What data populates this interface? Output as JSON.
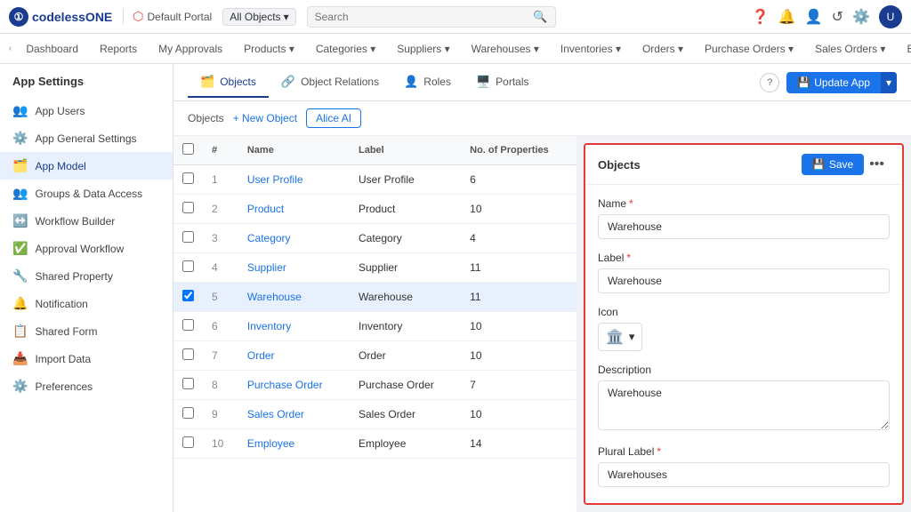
{
  "topBar": {
    "logo": "codelessONE",
    "portal": "Default Portal",
    "allObjects": "All Objects",
    "searchPlaceholder": "Search"
  },
  "secondNav": {
    "items": [
      {
        "label": "Dashboard"
      },
      {
        "label": "Reports"
      },
      {
        "label": "My Approvals"
      },
      {
        "label": "Products",
        "hasDropdown": true
      },
      {
        "label": "Categories",
        "hasDropdown": true
      },
      {
        "label": "Suppliers",
        "hasDropdown": true
      },
      {
        "label": "Warehouses",
        "hasDropdown": true
      },
      {
        "label": "Inventories",
        "hasDropdown": true
      },
      {
        "label": "Orders",
        "hasDropdown": true
      },
      {
        "label": "Purchase Orders",
        "hasDropdown": true
      },
      {
        "label": "Sales Orders",
        "hasDropdown": true
      },
      {
        "label": "Emplo…"
      }
    ]
  },
  "sidebar": {
    "title": "App Settings",
    "items": [
      {
        "label": "App Users",
        "icon": "👥"
      },
      {
        "label": "App General Settings",
        "icon": "⚙️"
      },
      {
        "label": "App Model",
        "icon": "🗂️",
        "active": true
      },
      {
        "label": "Groups & Data Access",
        "icon": "👥"
      },
      {
        "label": "Workflow Builder",
        "icon": "↔️"
      },
      {
        "label": "Approval Workflow",
        "icon": "✅"
      },
      {
        "label": "Shared Property",
        "icon": "🔧"
      },
      {
        "label": "Notification",
        "icon": "🔔"
      },
      {
        "label": "Shared Form",
        "icon": "📋"
      },
      {
        "label": "Import Data",
        "icon": "📥"
      },
      {
        "label": "Preferences",
        "icon": "⚙️"
      }
    ]
  },
  "tabs": [
    {
      "label": "Objects",
      "icon": "🗂️",
      "active": true
    },
    {
      "label": "Object Relations",
      "icon": "🔗"
    },
    {
      "label": "Roles",
      "icon": "👤"
    },
    {
      "label": "Portals",
      "icon": "🖥️"
    }
  ],
  "toolbar": {
    "objectsLabel": "Objects",
    "newObjectLabel": "+ New Object",
    "aiLabel": "Alice AI",
    "updateAppLabel": "Update App",
    "helpTooltip": "?"
  },
  "table": {
    "headers": [
      "#",
      "Name",
      "Label",
      "No. of Properties"
    ],
    "rows": [
      {
        "num": 1,
        "name": "User Profile",
        "label": "User Profile",
        "properties": 6
      },
      {
        "num": 2,
        "name": "Product",
        "label": "Product",
        "properties": 10
      },
      {
        "num": 3,
        "name": "Category",
        "label": "Category",
        "properties": 4
      },
      {
        "num": 4,
        "name": "Supplier",
        "label": "Supplier",
        "properties": 11
      },
      {
        "num": 5,
        "name": "Warehouse",
        "label": "Warehouse",
        "properties": 11,
        "selected": true
      },
      {
        "num": 6,
        "name": "Inventory",
        "label": "Inventory",
        "properties": 10
      },
      {
        "num": 7,
        "name": "Order",
        "label": "Order",
        "properties": 10
      },
      {
        "num": 8,
        "name": "Purchase Order",
        "label": "Purchase Order",
        "properties": 7
      },
      {
        "num": 9,
        "name": "Sales Order",
        "label": "Sales Order",
        "properties": 10
      },
      {
        "num": 10,
        "name": "Employee",
        "label": "Employee",
        "properties": 14
      }
    ]
  },
  "rightPanel": {
    "title": "Objects",
    "saveLabel": "Save",
    "moreIcon": "•••",
    "fields": {
      "nameLabel": "Name",
      "nameValue": "Warehouse",
      "labelLabel": "Label",
      "labelValue": "Warehouse",
      "iconLabel": "Icon",
      "descriptionLabel": "Description",
      "descriptionValue": "Warehouse",
      "pluralLabelLabel": "Plural Label",
      "pluralLabelValue": "Warehouses"
    }
  }
}
